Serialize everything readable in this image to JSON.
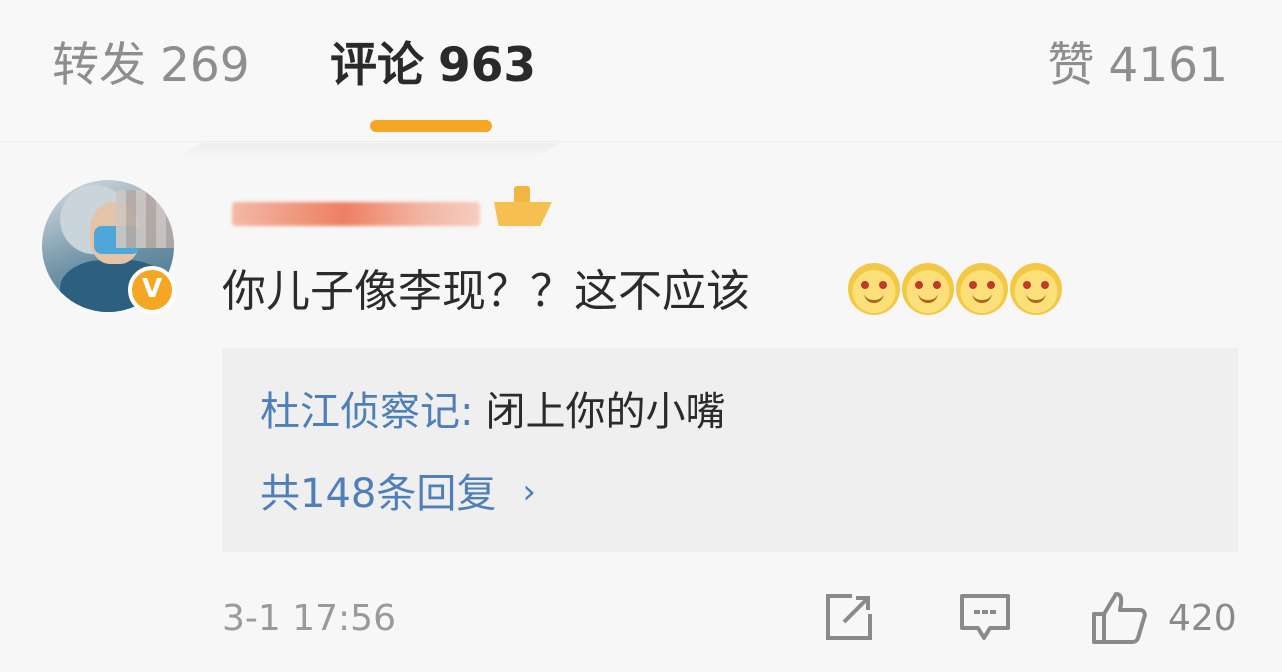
{
  "tabs": {
    "reposts": {
      "label": "转发",
      "count": "269"
    },
    "comments": {
      "label": "评论",
      "count": "963",
      "active": true
    },
    "likes": {
      "label": "赞",
      "count": "4161"
    }
  },
  "comment": {
    "text": "你儿子像李现？？这不应该",
    "emoji": [
      "smile-emoji",
      "smile-emoji",
      "smile-emoji",
      "smile-emoji"
    ],
    "timestamp": "3-1 17:56",
    "like_count": "420",
    "badge_label": "V",
    "reply": {
      "author": "杜江侦察记",
      "separator": ":",
      "text": "闭上你的小嘴",
      "count_text": "共148条回复",
      "chevron": "›"
    }
  },
  "colors": {
    "accent": "#f5a623",
    "link": "#4f7fb8",
    "text": "#2b2b2b",
    "muted": "#9a9a9a"
  }
}
